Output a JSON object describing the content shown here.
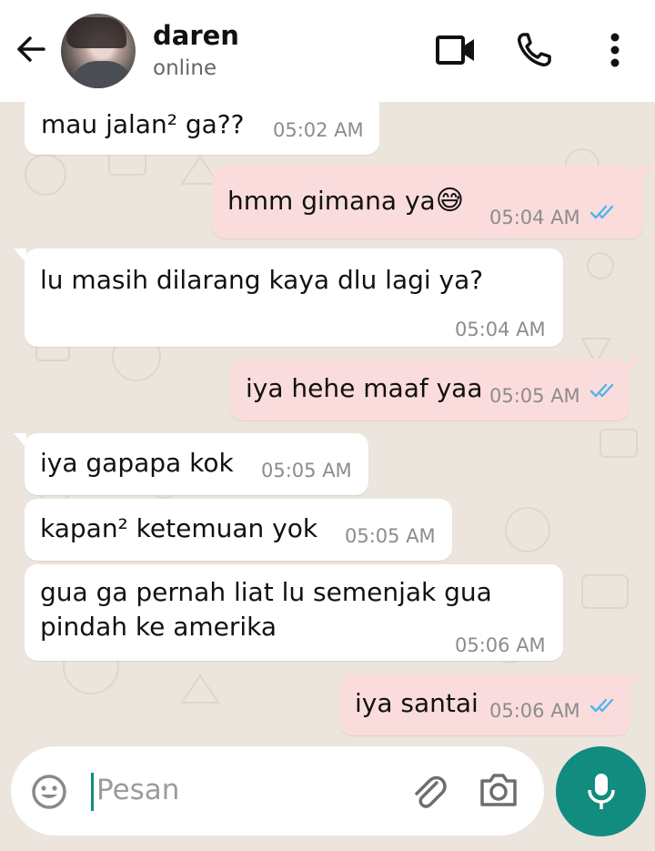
{
  "contact": {
    "name": "daren",
    "status": "online"
  },
  "messages": [
    {
      "direction": "in",
      "text": "mau jalan² ga??",
      "time": "05:02 AM"
    },
    {
      "direction": "out",
      "text": "hmm gimana ya",
      "emoji": "😅",
      "time": "05:04 AM",
      "read": true
    },
    {
      "direction": "in",
      "text": "lu masih dilarang kaya dlu lagi ya?",
      "time": "05:04 AM"
    },
    {
      "direction": "out",
      "text": "iya hehe maaf yaa",
      "time": "05:05 AM",
      "read": true
    },
    {
      "direction": "in",
      "text": "iya gapapa kok",
      "time": "05:05 AM"
    },
    {
      "direction": "in",
      "text": "kapan² ketemuan yok",
      "time": "05:05 AM"
    },
    {
      "direction": "in",
      "lines": [
        "gua ga pernah liat lu semenjak gua",
        "pindah ke amerika"
      ],
      "time": "05:06 AM"
    },
    {
      "direction": "out",
      "text": "iya santai",
      "time": "05:06 AM",
      "read": true
    }
  ],
  "composer": {
    "placeholder": "Pesan"
  },
  "colors": {
    "header_bg": "#ffffff",
    "chat_bg": "#ece5dd",
    "incoming_bubble": "#ffffff",
    "outgoing_bubble": "#fbdcdd",
    "read_tick": "#4fb6ec",
    "accent": "#128c7e"
  },
  "icons": {
    "back": "arrow-left-icon",
    "video": "video-call-icon",
    "call": "phone-icon",
    "menu": "more-vert-icon",
    "emoji": "emoji-icon",
    "attach": "paperclip-icon",
    "camera": "camera-icon",
    "mic": "mic-icon"
  }
}
